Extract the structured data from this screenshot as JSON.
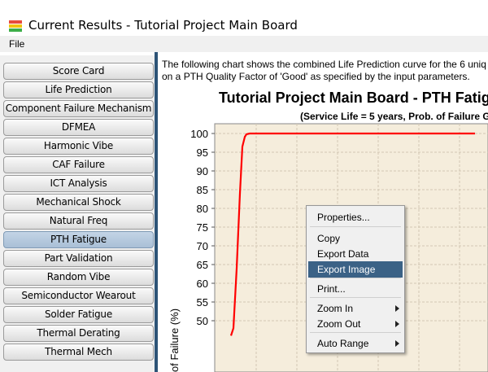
{
  "window": {
    "title": "Current Results - Tutorial Project Main Board",
    "icon": "app-icon"
  },
  "menu": {
    "file": "File"
  },
  "sidebar": {
    "items": [
      {
        "label": "Score Card",
        "active": false
      },
      {
        "label": "Life Prediction",
        "active": false
      },
      {
        "label": "Component Failure Mechanism",
        "active": false
      },
      {
        "label": "DFMEA",
        "active": false
      },
      {
        "label": "Harmonic Vibe",
        "active": false
      },
      {
        "label": "CAF Failure",
        "active": false
      },
      {
        "label": "ICT Analysis",
        "active": false
      },
      {
        "label": "Mechanical Shock",
        "active": false
      },
      {
        "label": "Natural Freq",
        "active": false
      },
      {
        "label": "PTH Fatigue",
        "active": true
      },
      {
        "label": "Part Validation",
        "active": false
      },
      {
        "label": "Random Vibe",
        "active": false
      },
      {
        "label": "Semiconductor Wearout",
        "active": false
      },
      {
        "label": "Solder Fatigue",
        "active": false
      },
      {
        "label": "Thermal Derating",
        "active": false
      },
      {
        "label": "Thermal Mech",
        "active": false
      }
    ]
  },
  "content": {
    "intro_line1": "The following chart shows the combined Life Prediction curve for  the 6 uniq",
    "intro_line2": "on a PTH Quality Factor of 'Good' as specified by the input parameters."
  },
  "chart_data": {
    "type": "line",
    "title": "Tutorial Project Main Board - PTH Fatig",
    "subtitle": "(Service Life = 5 years, Prob. of Failure G",
    "ylabel": "of Failure (%)",
    "yticks": [
      50,
      55,
      60,
      65,
      70,
      75,
      80,
      85,
      90,
      95,
      100
    ],
    "ylim": [
      48,
      102
    ],
    "grid": true,
    "line_color": "#ff0000",
    "plot_background": "#f5eddc",
    "series": [
      {
        "x": [
          0.0,
          0.6,
          1.4,
          2.2,
          2.8,
          3.4,
          3.8,
          4.6,
          6,
          10,
          60
        ],
        "values": [
          46,
          48,
          64,
          84,
          96.5,
          99.1,
          99.8,
          100,
          100,
          100,
          100
        ]
      }
    ]
  },
  "context_menu": {
    "items": [
      {
        "label": "Properties...",
        "submenu": false,
        "highlight": false
      },
      {
        "label": "Copy",
        "submenu": false,
        "highlight": false
      },
      {
        "label": "Export Data",
        "submenu": false,
        "highlight": false
      },
      {
        "label": "Export Image",
        "submenu": false,
        "highlight": true
      },
      {
        "label": "Print...",
        "submenu": false,
        "highlight": false
      },
      {
        "label": "Zoom In",
        "submenu": true,
        "highlight": false
      },
      {
        "label": "Zoom Out",
        "submenu": true,
        "highlight": false
      },
      {
        "label": "Auto Range",
        "submenu": true,
        "highlight": false
      }
    ]
  }
}
